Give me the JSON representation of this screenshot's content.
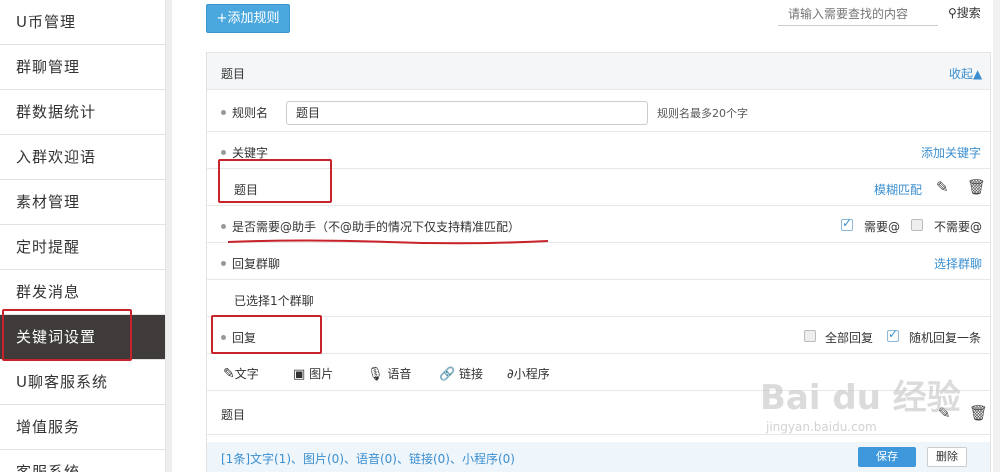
{
  "sidebar": {
    "items": [
      {
        "label": "U币管理"
      },
      {
        "label": "群聊管理"
      },
      {
        "label": "群数据统计"
      },
      {
        "label": "入群欢迎语"
      },
      {
        "label": "素材管理"
      },
      {
        "label": "定时提醒"
      },
      {
        "label": "群发消息"
      },
      {
        "label": "关键词设置",
        "active": true
      },
      {
        "label": "U聊客服系统"
      },
      {
        "label": "增值服务"
      },
      {
        "label": "客服系统"
      }
    ]
  },
  "toolbar": {
    "add_label": "+添加规则",
    "search_placeholder": "请输入需要查找的内容",
    "search_label": "搜索"
  },
  "panel": {
    "title": "题目",
    "collapse_label": "收起▲",
    "rule_name_label": "规则名",
    "rule_name_value": "题目",
    "rule_name_hint": "规则名最多20个字",
    "keyword_label": "关键字",
    "add_keyword_label": "添加关键字",
    "keyword_value": "题目",
    "match_mode_label": "模糊匹配",
    "at_question": "是否需要@助手（不@助手的情况下仅支持精准匹配）",
    "need_at_label": "需要@",
    "no_need_at_label": "不需要@",
    "reply_group_label": "回复群聊",
    "select_group_label": "选择群聊",
    "selected_groups": "已选择1个群聊",
    "reply_label": "回复",
    "reply_all_label": "全部回复",
    "reply_random_label": "随机回复一条",
    "tabs": [
      "文字",
      "图片",
      "语音",
      "链接",
      "小程序"
    ],
    "reply_content": "题目",
    "summary": "[1条]文字(1)、图片(0)、语音(0)、链接(0)、小程序(0)",
    "save_label": "保存",
    "delete_label": "删除"
  },
  "watermark": {
    "text": "Bai du 经验",
    "url": "jingyan.baidu.com"
  },
  "colors": {
    "accent": "#3b8fd0",
    "sidebar_active": "#3f3b3a",
    "annotation_red": "#c8222a"
  }
}
